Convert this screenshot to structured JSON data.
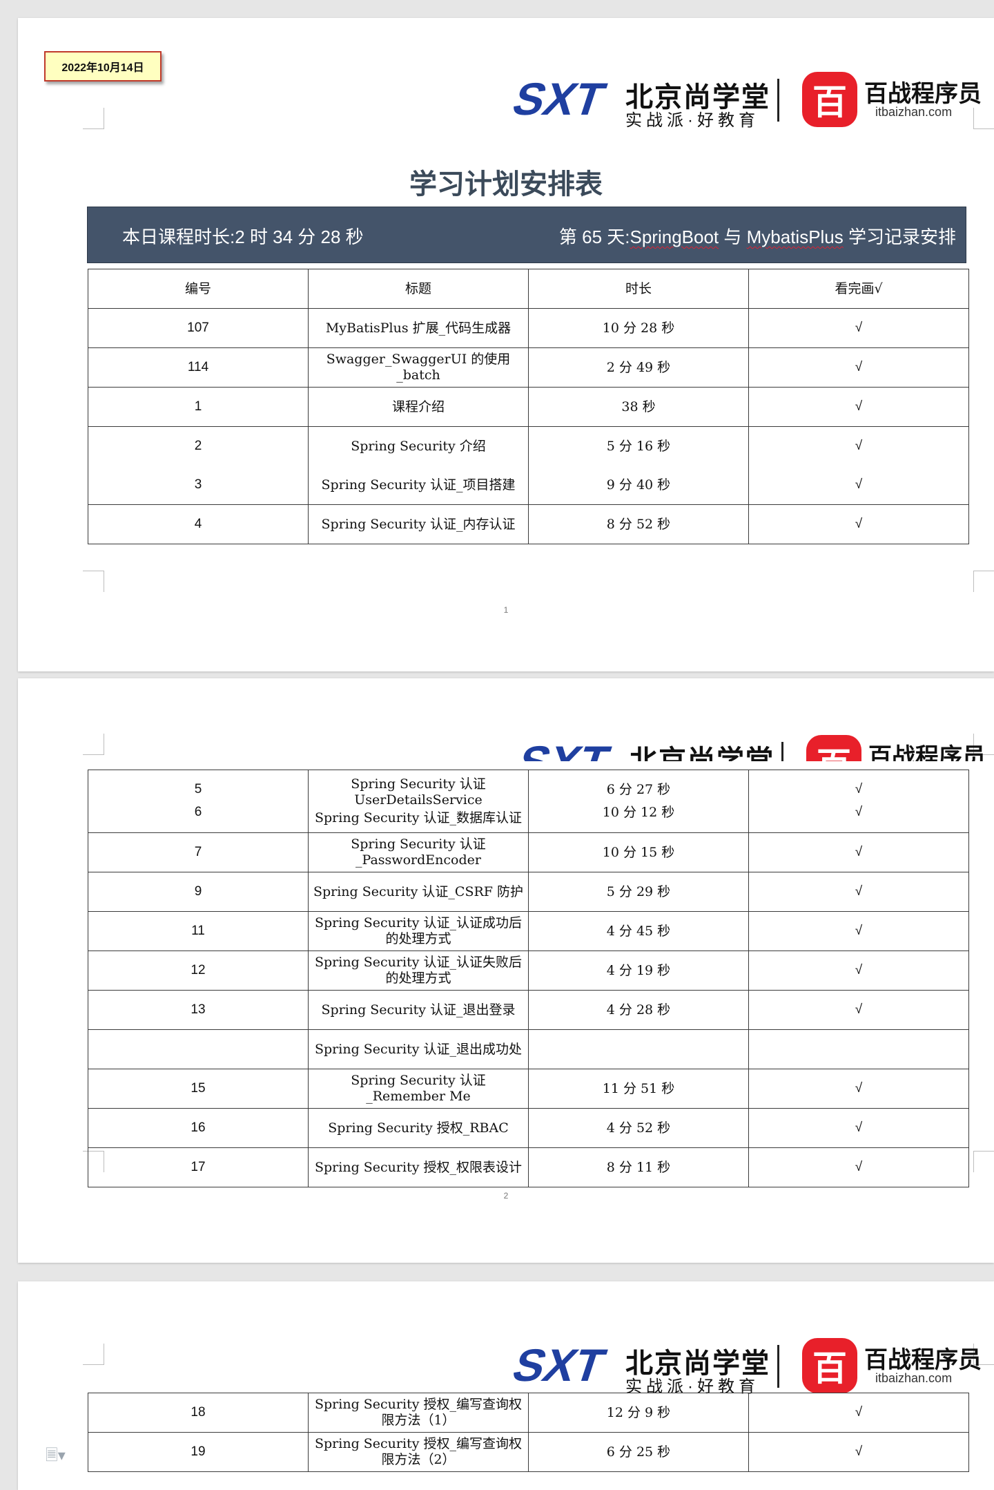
{
  "date_stamp": "2022年10月14日",
  "brand": {
    "sxt": "SXT",
    "cn_name": "北京尚学堂",
    "slogan": "实战派·好教育",
    "bz_badge": "百",
    "bz_name": "百战程序员",
    "bz_site": "itbaizhan.com",
    "colors": {
      "sxt_blue": "#1f3fa0",
      "bz_red": "#e8202a",
      "banner": "#44546a"
    }
  },
  "title": "学习计划安排表",
  "banner": {
    "left": "本日课程时长:2 时 34 分 28 秒",
    "right_pre": "第 65 天:",
    "right_wave1": "SpringBoot",
    "right_mid": " 与 ",
    "right_wave2": "MybatisPlus",
    "right_post": " 学习记录安排"
  },
  "table": {
    "headers": [
      "编号",
      "标题",
      "时长",
      "看完画√"
    ],
    "check": "√",
    "page1_rows": [
      {
        "num": "107",
        "title": "MyBatisPlus 扩展_代码生成器",
        "duration": "10 分 28 秒"
      },
      {
        "num": "114",
        "title": "Swagger_SwaggerUI 的使用_batch",
        "duration": "2 分 49 秒"
      },
      {
        "num": "1",
        "title": "课程介绍",
        "duration": "38 秒"
      },
      {
        "num": "2",
        "title": "Spring Security 介绍",
        "duration": "5 分 16 秒"
      },
      {
        "num": "3",
        "title": "Spring Security 认证_项目搭建",
        "duration": "9 分 40 秒"
      },
      {
        "num": "4",
        "title": "Spring Security 认证_内存认证",
        "duration": "8 分 52 秒"
      }
    ],
    "page2_rows": [
      {
        "num": "5",
        "title": "Spring Security 认证 UserDetailsService",
        "duration": "6 分 27 秒"
      },
      {
        "num": "6",
        "title": "Spring Security 认证_数据库认证",
        "duration": "10 分 12 秒"
      },
      {
        "num": "7",
        "title": "Spring Security 认证_PasswordEncoder",
        "duration": "10 分 15 秒"
      },
      {
        "num": "9",
        "title": "Spring Security 认证_CSRF 防护",
        "duration": "5 分 29 秒"
      },
      {
        "num": "11",
        "title": "Spring Security 认证_认证成功后的处理方式",
        "duration": "4 分 45 秒"
      },
      {
        "num": "12",
        "title": "Spring Security 认证_认证失败后的处理方式",
        "duration": "4 分 19 秒"
      },
      {
        "num": "13",
        "title": "Spring Security 认证_退出登录",
        "duration": "4 分 28 秒"
      },
      {
        "num": "",
        "title": "Spring Security 认证_退出成功处",
        "duration": ""
      },
      {
        "num": "15",
        "title": "Spring Security 认证_Remember Me",
        "duration": "11 分 51 秒"
      },
      {
        "num": "16",
        "title": "Spring Security 授权_RBAC",
        "duration": "4 分 52 秒"
      },
      {
        "num": "17",
        "title": "Spring Security 授权_权限表设计",
        "duration": "8 分 11 秒"
      }
    ],
    "page3_rows": [
      {
        "num": "18",
        "title": "Spring Security 授权_编写查询权限方法（1）",
        "duration": "12 分 9 秒"
      },
      {
        "num": "19",
        "title": "Spring Security 授权_编写查询权限方法（2）",
        "duration": "6 分 25 秒"
      }
    ]
  },
  "page_numbers": [
    "1",
    "2"
  ],
  "doc_icon": "document-icon"
}
